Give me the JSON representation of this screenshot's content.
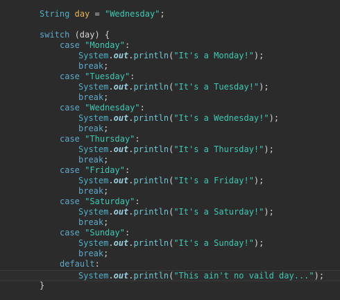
{
  "editor": {
    "lines": [
      {
        "id": "l1",
        "tokens": [
          {
            "k": "cls",
            "t": "String"
          },
          {
            "k": "plain",
            "t": " "
          },
          {
            "k": "var",
            "t": "day"
          },
          {
            "k": "plain",
            "t": " = "
          },
          {
            "k": "str",
            "t": "\"Wednesday\""
          },
          {
            "k": "plain",
            "t": ";"
          }
        ]
      },
      {
        "id": "l2",
        "tokens": []
      },
      {
        "id": "l3",
        "tokens": [
          {
            "k": "kw",
            "t": "switch"
          },
          {
            "k": "plain",
            "t": " (day) {"
          }
        ]
      },
      {
        "id": "l4",
        "tokens": [
          {
            "k": "kw",
            "t": "case"
          },
          {
            "k": "plain",
            "t": " "
          },
          {
            "k": "str",
            "t": "\"Monday\""
          },
          {
            "k": "plain",
            "t": ":"
          }
        ]
      },
      {
        "id": "l5",
        "tokens": [
          {
            "k": "cls",
            "t": "System"
          },
          {
            "k": "plain",
            "t": "."
          },
          {
            "k": "fld",
            "t": "out"
          },
          {
            "k": "plain",
            "t": "."
          },
          {
            "k": "mth",
            "t": "println"
          },
          {
            "k": "plain",
            "t": "("
          },
          {
            "k": "str",
            "t": "\"It's a Monday!\""
          },
          {
            "k": "plain",
            "t": ");"
          }
        ]
      },
      {
        "id": "l6",
        "tokens": [
          {
            "k": "kw",
            "t": "break"
          },
          {
            "k": "plain",
            "t": ";"
          }
        ]
      },
      {
        "id": "l7",
        "tokens": [
          {
            "k": "kw",
            "t": "case"
          },
          {
            "k": "plain",
            "t": " "
          },
          {
            "k": "str",
            "t": "\"Tuesday\""
          },
          {
            "k": "plain",
            "t": ":"
          }
        ]
      },
      {
        "id": "l8",
        "tokens": [
          {
            "k": "cls",
            "t": "System"
          },
          {
            "k": "plain",
            "t": "."
          },
          {
            "k": "fld",
            "t": "out"
          },
          {
            "k": "plain",
            "t": "."
          },
          {
            "k": "mth",
            "t": "println"
          },
          {
            "k": "plain",
            "t": "("
          },
          {
            "k": "str",
            "t": "\"It's a Tuesday!\""
          },
          {
            "k": "plain",
            "t": ");"
          }
        ]
      },
      {
        "id": "l9",
        "tokens": [
          {
            "k": "kw",
            "t": "break"
          },
          {
            "k": "plain",
            "t": ";"
          }
        ]
      },
      {
        "id": "l10",
        "tokens": [
          {
            "k": "kw",
            "t": "case"
          },
          {
            "k": "plain",
            "t": " "
          },
          {
            "k": "str",
            "t": "\"Wednesday\""
          },
          {
            "k": "plain",
            "t": ":"
          }
        ]
      },
      {
        "id": "l11",
        "tokens": [
          {
            "k": "cls",
            "t": "System"
          },
          {
            "k": "plain",
            "t": "."
          },
          {
            "k": "fld",
            "t": "out"
          },
          {
            "k": "plain",
            "t": "."
          },
          {
            "k": "mth",
            "t": "println"
          },
          {
            "k": "plain",
            "t": "("
          },
          {
            "k": "str",
            "t": "\"It's a Wednesday!\""
          },
          {
            "k": "plain",
            "t": ");"
          }
        ]
      },
      {
        "id": "l12",
        "tokens": [
          {
            "k": "kw",
            "t": "break"
          },
          {
            "k": "plain",
            "t": ";"
          }
        ]
      },
      {
        "id": "l13",
        "tokens": [
          {
            "k": "kw",
            "t": "case"
          },
          {
            "k": "plain",
            "t": " "
          },
          {
            "k": "str",
            "t": "\"Thursday\""
          },
          {
            "k": "plain",
            "t": ":"
          }
        ]
      },
      {
        "id": "l14",
        "tokens": [
          {
            "k": "cls",
            "t": "System"
          },
          {
            "k": "plain",
            "t": "."
          },
          {
            "k": "fld",
            "t": "out"
          },
          {
            "k": "plain",
            "t": "."
          },
          {
            "k": "mth",
            "t": "println"
          },
          {
            "k": "plain",
            "t": "("
          },
          {
            "k": "str",
            "t": "\"It's a Thursday!\""
          },
          {
            "k": "plain",
            "t": ");"
          }
        ]
      },
      {
        "id": "l15",
        "tokens": [
          {
            "k": "kw",
            "t": "break"
          },
          {
            "k": "plain",
            "t": ";"
          }
        ]
      },
      {
        "id": "l16",
        "tokens": [
          {
            "k": "kw",
            "t": "case"
          },
          {
            "k": "plain",
            "t": " "
          },
          {
            "k": "str",
            "t": "\"Friday\""
          },
          {
            "k": "plain",
            "t": ":"
          }
        ]
      },
      {
        "id": "l17",
        "tokens": [
          {
            "k": "cls",
            "t": "System"
          },
          {
            "k": "plain",
            "t": "."
          },
          {
            "k": "fld",
            "t": "out"
          },
          {
            "k": "plain",
            "t": "."
          },
          {
            "k": "mth",
            "t": "println"
          },
          {
            "k": "plain",
            "t": "("
          },
          {
            "k": "str",
            "t": "\"It's a Friday!\""
          },
          {
            "k": "plain",
            "t": ");"
          }
        ]
      },
      {
        "id": "l18",
        "tokens": [
          {
            "k": "kw",
            "t": "break"
          },
          {
            "k": "plain",
            "t": ";"
          }
        ]
      },
      {
        "id": "l19",
        "tokens": [
          {
            "k": "kw",
            "t": "case"
          },
          {
            "k": "plain",
            "t": " "
          },
          {
            "k": "str",
            "t": "\"Saturday\""
          },
          {
            "k": "plain",
            "t": ":"
          }
        ]
      },
      {
        "id": "l20",
        "tokens": [
          {
            "k": "cls",
            "t": "System"
          },
          {
            "k": "plain",
            "t": "."
          },
          {
            "k": "fld",
            "t": "out"
          },
          {
            "k": "plain",
            "t": "."
          },
          {
            "k": "mth",
            "t": "println"
          },
          {
            "k": "plain",
            "t": "("
          },
          {
            "k": "str",
            "t": "\"It's a Saturday!\""
          },
          {
            "k": "plain",
            "t": ");"
          }
        ]
      },
      {
        "id": "l21",
        "tokens": [
          {
            "k": "kw",
            "t": "break"
          },
          {
            "k": "plain",
            "t": ";"
          }
        ]
      },
      {
        "id": "l22",
        "tokens": [
          {
            "k": "kw",
            "t": "case"
          },
          {
            "k": "plain",
            "t": " "
          },
          {
            "k": "str",
            "t": "\"Sunday\""
          },
          {
            "k": "plain",
            "t": ":"
          }
        ]
      },
      {
        "id": "l23",
        "tokens": [
          {
            "k": "cls",
            "t": "System"
          },
          {
            "k": "plain",
            "t": "."
          },
          {
            "k": "fld",
            "t": "out"
          },
          {
            "k": "plain",
            "t": "."
          },
          {
            "k": "mth",
            "t": "println"
          },
          {
            "k": "plain",
            "t": "("
          },
          {
            "k": "str",
            "t": "\"It's a Sunday!\""
          },
          {
            "k": "plain",
            "t": ");"
          }
        ]
      },
      {
        "id": "l24",
        "tokens": [
          {
            "k": "kw",
            "t": "break"
          },
          {
            "k": "plain",
            "t": ";"
          }
        ]
      },
      {
        "id": "l25",
        "tokens": [
          {
            "k": "kw",
            "t": "default"
          },
          {
            "k": "plain",
            "t": ":"
          }
        ]
      },
      {
        "id": "l26",
        "current": true,
        "tokens": [
          {
            "k": "cls",
            "t": "System"
          },
          {
            "k": "plain",
            "t": "."
          },
          {
            "k": "fld",
            "t": "out"
          },
          {
            "k": "plain",
            "t": "."
          },
          {
            "k": "mth",
            "t": "println"
          },
          {
            "k": "plain",
            "t": "("
          },
          {
            "k": "str",
            "t": "\"This ain't no vaild day...\""
          },
          {
            "k": "plain",
            "t": ");"
          }
        ]
      },
      {
        "id": "l27",
        "tokens": [
          {
            "k": "plain",
            "t": "}"
          }
        ]
      }
    ]
  }
}
